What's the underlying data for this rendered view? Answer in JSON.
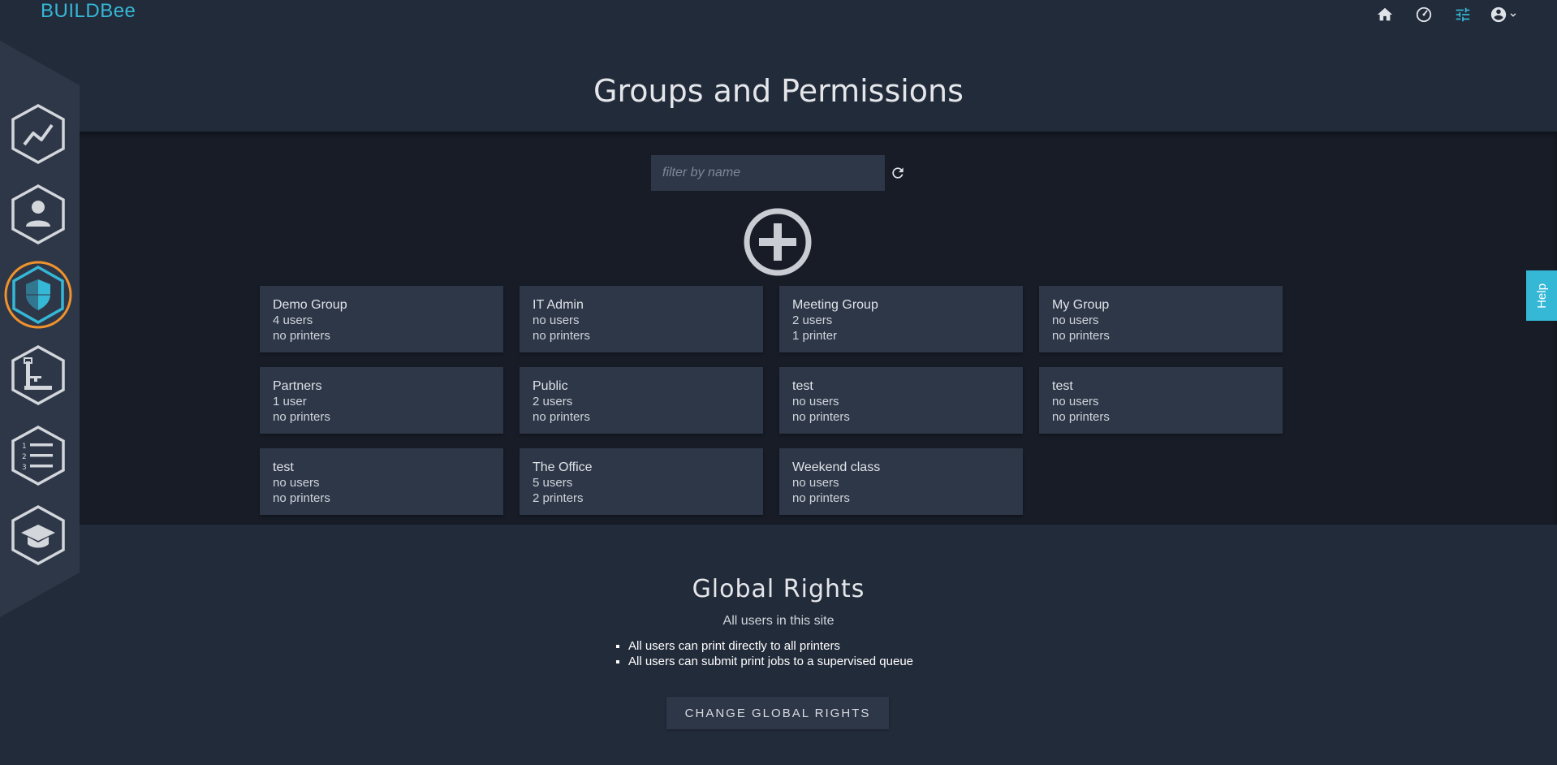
{
  "app": {
    "logo_text": "BUILDBee",
    "brand_color": "#35b7d6",
    "accent_active_color": "#f0922c"
  },
  "topbar": {
    "icons": [
      "home-icon",
      "speed-icon",
      "tune-icon",
      "account-icon"
    ]
  },
  "header": {
    "title": "Groups and Permissions"
  },
  "sidebar": {
    "items": [
      {
        "name": "trending-icon",
        "active": false
      },
      {
        "name": "user-icon",
        "active": false
      },
      {
        "name": "shield-icon",
        "active": true
      },
      {
        "name": "printer-icon",
        "active": false
      },
      {
        "name": "numbered-list-icon",
        "active": false
      },
      {
        "name": "graduation-cap-icon",
        "active": false
      }
    ]
  },
  "filter": {
    "placeholder": "filter by name"
  },
  "groups": [
    {
      "name": "Demo Group",
      "users": "4 users",
      "printers": "no printers"
    },
    {
      "name": "IT Admin",
      "users": "no users",
      "printers": "no printers"
    },
    {
      "name": "Meeting Group",
      "users": "2 users",
      "printers": "1 printer"
    },
    {
      "name": "My Group",
      "users": "no users",
      "printers": "no printers"
    },
    {
      "name": "Partners",
      "users": "1 user",
      "printers": "no printers"
    },
    {
      "name": "Public",
      "users": "2 users",
      "printers": "no printers"
    },
    {
      "name": "test",
      "users": "no users",
      "printers": "no printers"
    },
    {
      "name": "test",
      "users": "no users",
      "printers": "no printers"
    },
    {
      "name": "test",
      "users": "no users",
      "printers": "no printers"
    },
    {
      "name": "The Office",
      "users": "5 users",
      "printers": "2 printers"
    },
    {
      "name": "Weekend class",
      "users": "no users",
      "printers": "no printers"
    }
  ],
  "global": {
    "title": "Global Rights",
    "subtitle": "All users in this site",
    "rights": [
      "All users can print directly to all printers",
      "All users can submit print jobs to a supervised queue"
    ],
    "button_label": "CHANGE GLOBAL RIGHTS"
  },
  "help": {
    "label": "Help"
  }
}
